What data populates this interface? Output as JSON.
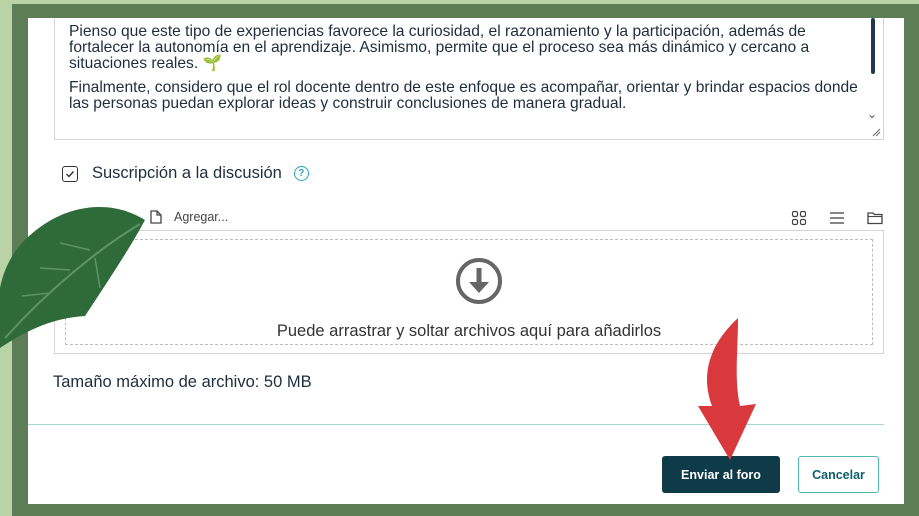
{
  "editor": {
    "paragraphs": [
      "Pienso que este tipo de experiencias favorece la curiosidad, el razonamiento y la participación, además de fortalecer la autonomía en el aprendizaje. Asimismo, permite que el proceso sea más dinámico y cercano a situaciones reales. 🌱",
      "Finalmente, considero que el rol docente dentro de este enfoque es acompañar, orientar y brindar espacios donde las personas puedan explorar ideas y construir conclusiones de manera gradual."
    ]
  },
  "subscription": {
    "label": "Suscripción a la discusión",
    "checked": true
  },
  "filepicker": {
    "add_label": "Agregar...",
    "drop_text": "Puede arrastrar y soltar archivos aquí para añadirlos",
    "max_size_label": "Tamaño máximo de archivo: 50 MB"
  },
  "actions": {
    "submit_label": "Enviar al foro",
    "cancel_label": "Cancelar"
  },
  "colors": {
    "background": "#b9d3a6",
    "frame": "#5c7d55",
    "primary": "#0f3a47",
    "accent": "#4fb7ae",
    "arrow": "#d9383d"
  }
}
